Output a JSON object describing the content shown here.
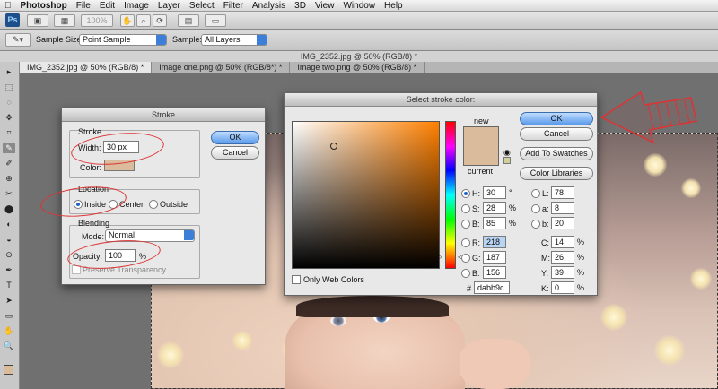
{
  "menubar": {
    "app": "Photoshop",
    "items": [
      "File",
      "Edit",
      "Image",
      "Layer",
      "Select",
      "Filter",
      "Analysis",
      "3D",
      "View",
      "Window",
      "Help"
    ]
  },
  "appbar": {
    "ps": "Ps",
    "zoom": "100%"
  },
  "options": {
    "sample_size_label": "Sample Size:",
    "sample_size_value": "Point Sample",
    "sample_label": "Sample:",
    "sample_value": "All Layers"
  },
  "window_title": "IMG_2352.jpg @ 50% (RGB/8) *",
  "tabs": [
    "IMG_2352.jpg @ 50% (RGB/8) *",
    "Image one.png @ 50% (RGB/8*) *",
    "Image two.png @ 50% (RGB/8) *"
  ],
  "stroke": {
    "title": "Stroke",
    "section_stroke": "Stroke",
    "width_label": "Width:",
    "width_value": "30 px",
    "color_label": "Color:",
    "section_location": "Location",
    "inside": "Inside",
    "center": "Center",
    "outside": "Outside",
    "section_blending": "Blending",
    "mode_label": "Mode:",
    "mode_value": "Normal",
    "opacity_label": "Opacity:",
    "opacity_value": "100",
    "opacity_unit": "%",
    "preserve": "Preserve Transparency",
    "ok": "OK",
    "cancel": "Cancel",
    "color": "#dabb9c"
  },
  "picker": {
    "title": "Select stroke color:",
    "new_label": "new",
    "current_label": "current",
    "ok": "OK",
    "cancel": "Cancel",
    "add_swatches": "Add To Swatches",
    "libraries": "Color Libraries",
    "h_label": "H:",
    "h": "30",
    "h_unit": "°",
    "s_label": "S:",
    "s": "28",
    "s_unit": "%",
    "b_label": "B:",
    "b": "85",
    "b_unit": "%",
    "r_label": "R:",
    "r": "218",
    "g_label": "G:",
    "g": "187",
    "bl_label": "B:",
    "bl": "156",
    "l_label": "L:",
    "l": "78",
    "a_label": "a:",
    "a": "8",
    "lb_label": "b:",
    "lb": "20",
    "c_label": "C:",
    "c": "14",
    "c_unit": "%",
    "m_label": "M:",
    "m": "26",
    "m_unit": "%",
    "y_label": "Y:",
    "y": "39",
    "y_unit": "%",
    "k_label": "K:",
    "k": "0",
    "k_unit": "%",
    "hex_label": "#",
    "hex": "dabb9c",
    "web_colors": "Only Web Colors",
    "color": "#dabb9c",
    "hue_color": "#ff8000"
  },
  "tools": [
    "▸",
    "⬚",
    "◌",
    "✥",
    "⌗",
    "✎",
    "✐",
    "⊕",
    "✂",
    "⬤",
    "◐",
    "◒",
    "⊙",
    "✒",
    "T",
    "➤",
    "▭",
    "✋",
    "🔍"
  ]
}
